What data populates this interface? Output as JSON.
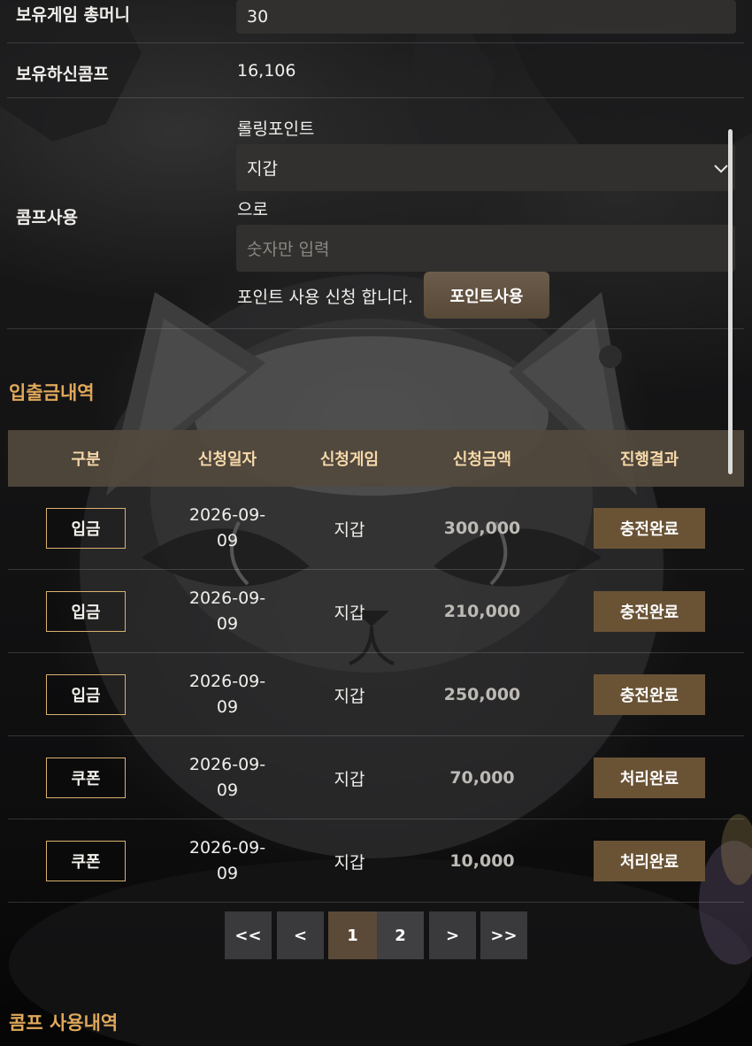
{
  "form": {
    "game_money": {
      "label": "보유게임 총머니",
      "value": "30"
    },
    "comp_owned": {
      "label": "보유하신콤프",
      "value": "16,106"
    },
    "comp_use": {
      "label": "콤프사용",
      "rolling_label": "롤링포인트",
      "select_value": "지갑",
      "to_label": "으로",
      "amount_placeholder": "숫자만 입력",
      "request_text": "포인트 사용 신청 합니다.",
      "button_label": "포인트사용"
    }
  },
  "history": {
    "title": "입출금내역",
    "columns": [
      "구분",
      "신청일자",
      "신청게임",
      "신청금액",
      "진행결과"
    ],
    "rows": [
      {
        "type": "입금",
        "date_line1": "2026-09-",
        "date_line2": "09",
        "game": "지갑",
        "amount": "300,000",
        "result": "충전완료"
      },
      {
        "type": "입금",
        "date_line1": "2026-09-",
        "date_line2": "09",
        "game": "지갑",
        "amount": "210,000",
        "result": "충전완료"
      },
      {
        "type": "입금",
        "date_line1": "2026-09-",
        "date_line2": "09",
        "game": "지갑",
        "amount": "250,000",
        "result": "충전완료"
      },
      {
        "type": "쿠폰",
        "date_line1": "2026-09-",
        "date_line2": "09",
        "game": "지갑",
        "amount": "70,000",
        "result": "처리완료"
      },
      {
        "type": "쿠폰",
        "date_line1": "2026-09-",
        "date_line2": "09",
        "game": "지갑",
        "amount": "10,000",
        "result": "처리완료"
      }
    ]
  },
  "pagination": {
    "first": "<<",
    "prev": "<",
    "pages": [
      "1",
      "2"
    ],
    "current_page": "1",
    "next": ">",
    "last": ">>"
  },
  "comp_history": {
    "title": "콤프 사용내역"
  },
  "icons": {
    "select": "chevron-down-icon"
  },
  "colors": {
    "accent": "#e0a85a",
    "header_bg": "#52483d",
    "result_btn": "#6a5335"
  }
}
